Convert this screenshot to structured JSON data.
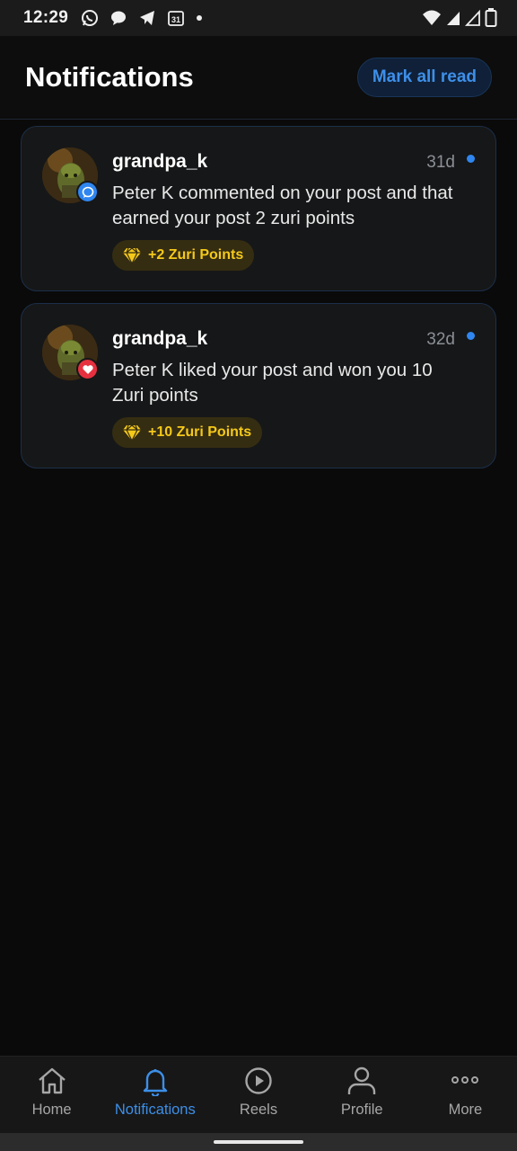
{
  "status_bar": {
    "time": "12:29",
    "left_icons": [
      "whatsapp-icon",
      "chat-bubble-icon",
      "telegram-icon",
      "calendar-icon",
      "dot-icon"
    ],
    "calendar_day": "31",
    "right_icons": [
      "wifi-icon",
      "signal-icon",
      "signal-icon",
      "battery-icon"
    ]
  },
  "header": {
    "title": "Notifications",
    "mark_all_read_label": "Mark all read"
  },
  "notifications": [
    {
      "user": "grandpa_k",
      "time": "31d",
      "message": "Peter K commented on your post and that earned your post 2 zuri points",
      "type_icon": "comment-icon",
      "type_color": "#2f86f0",
      "points_label": "+2 Zuri Points",
      "unread": true
    },
    {
      "user": "grandpa_k",
      "time": "32d",
      "message": "Peter K liked your post and won you 10 Zuri points",
      "type_icon": "heart-icon",
      "type_color": "#e6303f",
      "points_label": "+10 Zuri Points",
      "unread": true
    }
  ],
  "bottom_nav": {
    "items": [
      {
        "label": "Home",
        "icon": "home-icon",
        "active": false
      },
      {
        "label": "Notifications",
        "icon": "bell-icon",
        "active": true
      },
      {
        "label": "Reels",
        "icon": "play-icon",
        "active": false
      },
      {
        "label": "Profile",
        "icon": "user-icon",
        "active": false
      },
      {
        "label": "More",
        "icon": "more-icon",
        "active": false
      }
    ]
  },
  "colors": {
    "accent": "#3d8fe8",
    "background": "#0a0a0a",
    "card": "#161718",
    "points": "#f5c919"
  }
}
